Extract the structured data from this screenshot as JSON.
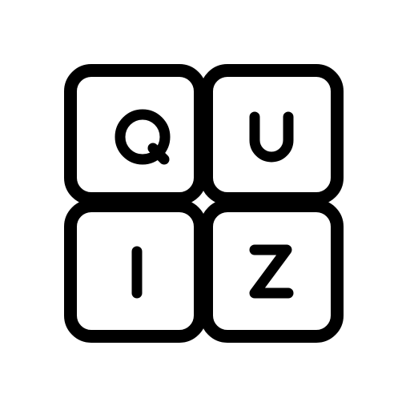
{
  "icon": {
    "name": "quiz-tiles-icon",
    "stroke_color": "#000000",
    "fill_color": "#ffffff",
    "background": "#ffffff"
  },
  "tiles": [
    {
      "letter": "Q",
      "icon": "q-letter-icon"
    },
    {
      "letter": "U",
      "icon": "u-letter-icon"
    },
    {
      "letter": "I",
      "icon": "i-letter-icon"
    },
    {
      "letter": "Z",
      "icon": "z-letter-icon"
    }
  ]
}
